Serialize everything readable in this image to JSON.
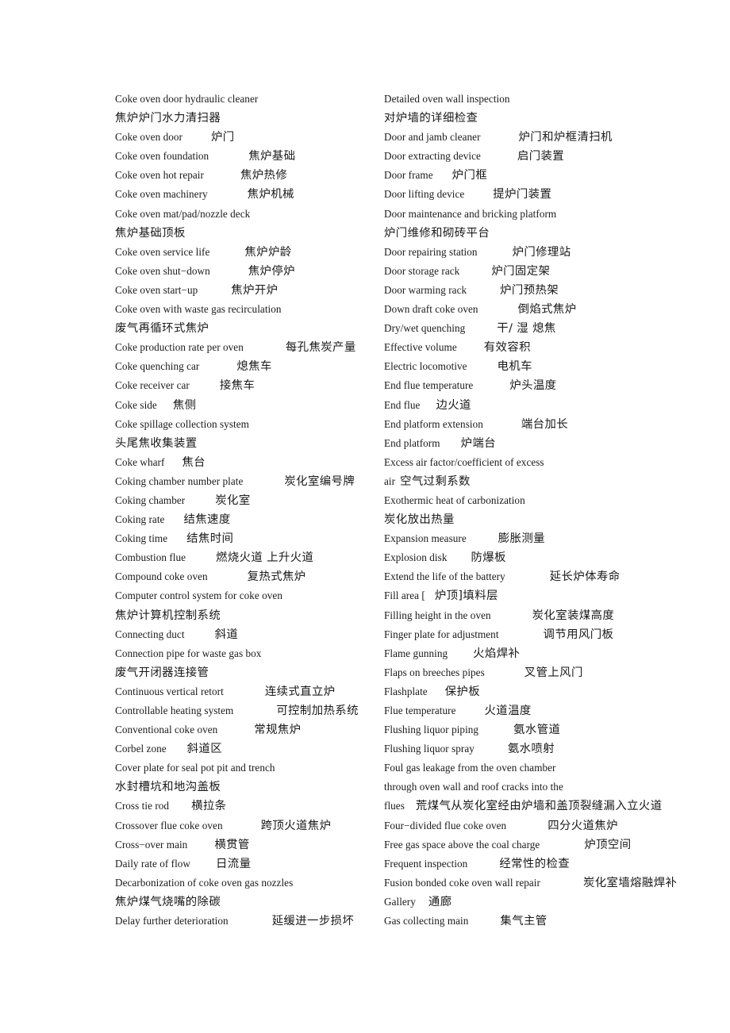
{
  "document": {
    "title": "Coke Oven Engineering Bilingual Glossary",
    "page_background": "#ffffff",
    "text_color": "#1a1a1a",
    "layout": "two-column bilingual term list (English term followed by Chinese gloss)"
  },
  "columns": {
    "left": {
      "name": "left-glossary-column",
      "entries": [
        {
          "en": "Coke oven door hydraulic cleaner",
          "gap": 0,
          "zh": ""
        },
        {
          "en": "",
          "gap": 0,
          "zh": "焦炉炉门水力清扫器"
        },
        {
          "en": "Coke oven door",
          "gap": 36,
          "zh": "炉门"
        },
        {
          "en": "Coke oven foundation",
          "gap": 50,
          "zh": "焦炉基础"
        },
        {
          "en": "Coke oven hot repair",
          "gap": 46,
          "zh": "焦炉热修"
        },
        {
          "en": "Coke oven machinery",
          "gap": 50,
          "zh": "焦炉机械"
        },
        {
          "en": "Coke oven mat/pad/nozzle deck",
          "gap": 0,
          "zh": ""
        },
        {
          "en": "",
          "gap": 0,
          "zh": "焦炉基础顶板"
        },
        {
          "en": "Coke oven service life",
          "gap": 44,
          "zh": "焦炉炉龄"
        },
        {
          "en": "Coke oven shut−down",
          "gap": 48,
          "zh": "焦炉停炉"
        },
        {
          "en": "Coke oven start−up",
          "gap": 42,
          "zh": "焦炉开炉"
        },
        {
          "en": "Coke oven with waste gas recirculation",
          "gap": 0,
          "zh": ""
        },
        {
          "en": "",
          "gap": 0,
          "zh": "废气再循环式焦炉"
        },
        {
          "en": "Coke production rate per oven",
          "gap": 53,
          "zh": "每孔焦炭产量"
        },
        {
          "en": "Coke quenching car",
          "gap": 47,
          "zh": "熄焦车"
        },
        {
          "en": "Coke receiver car",
          "gap": 38,
          "zh": "接焦车"
        },
        {
          "en": "Coke side",
          "gap": 20,
          "zh": "焦侧"
        },
        {
          "en": "Coke spillage collection system",
          "gap": 0,
          "zh": ""
        },
        {
          "en": "",
          "gap": 0,
          "zh": "头尾焦收集装置"
        },
        {
          "en": "Coke wharf",
          "gap": 22,
          "zh": "焦台"
        },
        {
          "en": "Coking chamber number plate",
          "gap": 52,
          "zh": "炭化室编号牌"
        },
        {
          "en": "Coking chamber",
          "gap": 38,
          "zh": "炭化室"
        },
        {
          "en": "Coking rate",
          "gap": 24,
          "zh": "结焦速度"
        },
        {
          "en": "Coking time",
          "gap": 24,
          "zh": "结焦时间"
        },
        {
          "en": "Combustion flue",
          "gap": 38,
          "zh": "燃烧火道 上升火道"
        },
        {
          "en": "Compound coke oven",
          "gap": 50,
          "zh": "复热式焦炉"
        },
        {
          "en": "Computer control system for coke oven",
          "gap": 0,
          "zh": ""
        },
        {
          "en": "",
          "gap": 0,
          "zh": "焦炉计算机控制系统"
        },
        {
          "en": "Connecting duct",
          "gap": 38,
          "zh": "斜道"
        },
        {
          "en": "Connection pipe for waste gas box",
          "gap": 0,
          "zh": ""
        },
        {
          "en": "",
          "gap": 0,
          "zh": "废气开闭器连接管"
        },
        {
          "en": "Continuous vertical retort",
          "gap": 52,
          "zh": "连续式直立炉"
        },
        {
          "en": "Controllable heating system",
          "gap": 54,
          "zh": "可控制加热系统"
        },
        {
          "en": "Conventional coke oven",
          "gap": 46,
          "zh": "常规焦炉"
        },
        {
          "en": "Corbel zone",
          "gap": 26,
          "zh": "斜道区"
        },
        {
          "en": "Cover plate for seal pot pit and trench",
          "gap": 0,
          "zh": ""
        },
        {
          "en": "",
          "gap": 0,
          "zh": "水封槽坑和地沟盖板"
        },
        {
          "en": "Cross tie rod",
          "gap": 28,
          "zh": "横拉条"
        },
        {
          "en": "Crossover flue coke oven",
          "gap": 48,
          "zh": "跨顶火道焦炉"
        },
        {
          "en": "Cross−over main",
          "gap": 34,
          "zh": "横贯管"
        },
        {
          "en": "Daily rate of flow",
          "gap": 32,
          "zh": "日流量"
        },
        {
          "en": "Decarbonization of coke oven gas nozzles",
          "gap": 0,
          "zh": ""
        },
        {
          "en": "",
          "gap": 0,
          "zh": "焦炉煤气烧嘴的除碳"
        },
        {
          "en": "Delay further deterioration",
          "gap": 55,
          "zh": "延缓进一步损坏"
        }
      ]
    },
    "right": {
      "name": "right-glossary-column",
      "entries": [
        {
          "en": "Detailed oven wall inspection",
          "gap": 0,
          "zh": ""
        },
        {
          "en": "",
          "gap": 0,
          "zh": "对炉墙的详细检查"
        },
        {
          "en": "Door and jamb cleaner",
          "gap": 48,
          "zh": "炉门和炉框清扫机"
        },
        {
          "en": "Door extracting device",
          "gap": 46,
          "zh": "启门装置"
        },
        {
          "en": "Door frame",
          "gap": 24,
          "zh": "炉门框"
        },
        {
          "en": "Door lifting device",
          "gap": 36,
          "zh": "提炉门装置"
        },
        {
          "en": "Door maintenance and bricking platform",
          "gap": 0,
          "zh": ""
        },
        {
          "en": "",
          "gap": 0,
          "zh": "炉门维修和砌砖平台"
        },
        {
          "en": "Door repairing station",
          "gap": 44,
          "zh": "炉门修理站"
        },
        {
          "en": "Door storage rack",
          "gap": 40,
          "zh": "炉门固定架"
        },
        {
          "en": "Door warming rack",
          "gap": 42,
          "zh": "炉门预热架"
        },
        {
          "en": "Down draft coke oven",
          "gap": 50,
          "zh": "倒焰式焦炉"
        },
        {
          "en": "Dry/wet quenching",
          "gap": 40,
          "zh": "干/ 湿 熄焦"
        },
        {
          "en": "Effective volume",
          "gap": 34,
          "zh": "有效容积"
        },
        {
          "en": "Electric locomotive",
          "gap": 38,
          "zh": "电机车"
        },
        {
          "en": "End flue temperature",
          "gap": 46,
          "zh": "炉头温度"
        },
        {
          "en": "End flue",
          "gap": 20,
          "zh": "边火道"
        },
        {
          "en": "End platform extension",
          "gap": 48,
          "zh": "端台加长"
        },
        {
          "en": "End platform",
          "gap": 26,
          "zh": "炉端台"
        },
        {
          "en": "Excess air factor/coefficient of excess",
          "gap": 0,
          "zh": ""
        },
        {
          "en": "air",
          "gap": 6,
          "zh": "空气过剩系数"
        },
        {
          "en": "Exothermic heat of carbonization",
          "gap": 0,
          "zh": ""
        },
        {
          "en": "",
          "gap": 0,
          "zh": "炭化放出热量"
        },
        {
          "en": "Expansion measure",
          "gap": 40,
          "zh": "膨胀测量"
        },
        {
          "en": "Explosion disk",
          "gap": 30,
          "zh": "防爆板"
        },
        {
          "en": "Extend the life of the battery",
          "gap": 56,
          "zh": "延长炉体寿命"
        },
        {
          "en": "Fill area [",
          "gap": 12,
          "zh": "炉顶]填料层"
        },
        {
          "en": "Filling height in the oven",
          "gap": 52,
          "zh": "炭化室装煤高度"
        },
        {
          "en": "Finger plate for adjustment",
          "gap": 56,
          "zh": "调节用风门板"
        },
        {
          "en": "Flame gunning",
          "gap": 32,
          "zh": "火焰焊补"
        },
        {
          "en": "Flaps on breeches pipes",
          "gap": 50,
          "zh": "叉管上风门"
        },
        {
          "en": "Flashplate",
          "gap": 22,
          "zh": "保护板"
        },
        {
          "en": "Flue temperature",
          "gap": 36,
          "zh": "火道温度"
        },
        {
          "en": "Flushing liquor piping",
          "gap": 44,
          "zh": "氨水管道"
        },
        {
          "en": "Flushing liquor spray",
          "gap": 42,
          "zh": "氨水喷射"
        },
        {
          "en": "Foul gas leakage from the oven chamber",
          "gap": 0,
          "zh": ""
        },
        {
          "en": "through oven wall and roof cracks into the",
          "gap": 0,
          "zh": ""
        },
        {
          "en": "flues",
          "gap": 14,
          "zh": "荒煤气从炭化室经由炉墙和盖顶裂缝漏入立火道"
        },
        {
          "en": "Four−divided flue coke oven",
          "gap": 52,
          "zh": "四分火道焦炉"
        },
        {
          "en": "Free gas space above the coal charge",
          "gap": 56,
          "zh": "炉顶空间"
        },
        {
          "en": "Frequent inspection",
          "gap": 40,
          "zh": "经常性的检查"
        },
        {
          "en": "Fusion bonded coke oven wall repair",
          "gap": 54,
          "zh": "炭化室墙熔融焊补"
        },
        {
          "en": "Gallery",
          "gap": 16,
          "zh": "通廊"
        },
        {
          "en": "Gas collecting main",
          "gap": 40,
          "zh": "集气主管"
        }
      ]
    }
  }
}
